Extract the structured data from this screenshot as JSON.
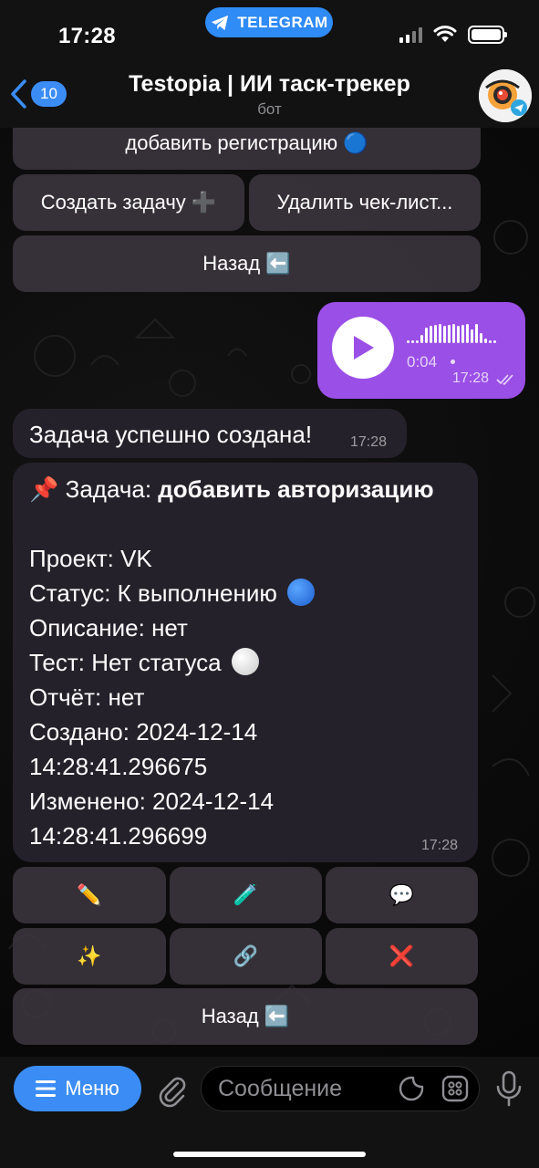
{
  "status_bar": {
    "time": "17:28",
    "telegram_label": "TELEGRAM"
  },
  "header": {
    "back_count": "10",
    "title": "Testopia | ИИ таск-трекер",
    "subtitle": "бот"
  },
  "top_keyboard": {
    "partial_button": "добавить регистрацию 🔵",
    "create_task": "Создать задачу ➕",
    "delete_checklist": "Удалить чек-лист...",
    "back": "Назад ⬅️"
  },
  "voice_message": {
    "duration": "0:04",
    "time": "17:28"
  },
  "success_message": {
    "text": "Задача успешно создана!",
    "time": "17:28"
  },
  "task_message": {
    "pin": "📌",
    "task_label": "Задача: ",
    "task_name": "добавить авторизацию",
    "project": "Проект: VK",
    "status": "Статус: К выполнению",
    "description": "Описание: нет",
    "test": "Тест: Нет статуса",
    "report": "Отчёт: нет",
    "created_line1": "Создано: 2024-12-14",
    "created_line2": "14:28:41.296675",
    "modified_line1": "Изменено: 2024-12-14",
    "modified_line2": "14:28:41.296699",
    "time": "17:28"
  },
  "task_keyboard": {
    "edit": "✏️",
    "test": "🧪",
    "comment": "💬",
    "ai": "✨",
    "link": "🔗",
    "delete": "❌",
    "back": "Назад ⬅️"
  },
  "bottom_bar": {
    "menu_label": "Меню",
    "input_placeholder": "Сообщение"
  },
  "colors": {
    "accent": "#3b8df5",
    "outgoing_bubble": "#9a4fe6",
    "status_dot": "#2f7ae5"
  }
}
